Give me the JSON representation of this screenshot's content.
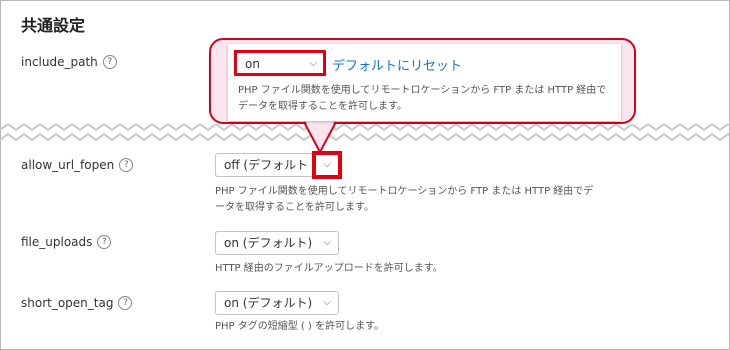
{
  "section_title": "共通設定",
  "rows": [
    {
      "label": "include_path",
      "help": "?"
    },
    {
      "label": "allow_url_fopen",
      "help": "?",
      "value": "off (デフォルト",
      "desc": "PHP ファイル関数を使用してリモートロケーションから FTP または HTTP 経由でデータを取得することを許可します。"
    },
    {
      "label": "file_uploads",
      "help": "?",
      "value": "on (デフォルト)",
      "desc": "HTTP 経由のファイルアップロードを許可します。"
    },
    {
      "label": "short_open_tag",
      "help": "?",
      "value": "on (デフォルト)",
      "desc": "PHP タグの短縮型 ( ) を許可します。"
    }
  ],
  "callout": {
    "select_value": "on",
    "reset_link": "デフォルトにリセット",
    "desc": "PHP ファイル関数を使用してリモートロケーションから FTP または HTTP 経由でデータを取得することを許可します。"
  },
  "icons": {
    "chevron": "chevron-down-icon",
    "help": "help-circle-icon"
  },
  "colors": {
    "highlight": "#e00012",
    "callout_bg": "#fbe6ef",
    "link": "#1a73c7"
  }
}
